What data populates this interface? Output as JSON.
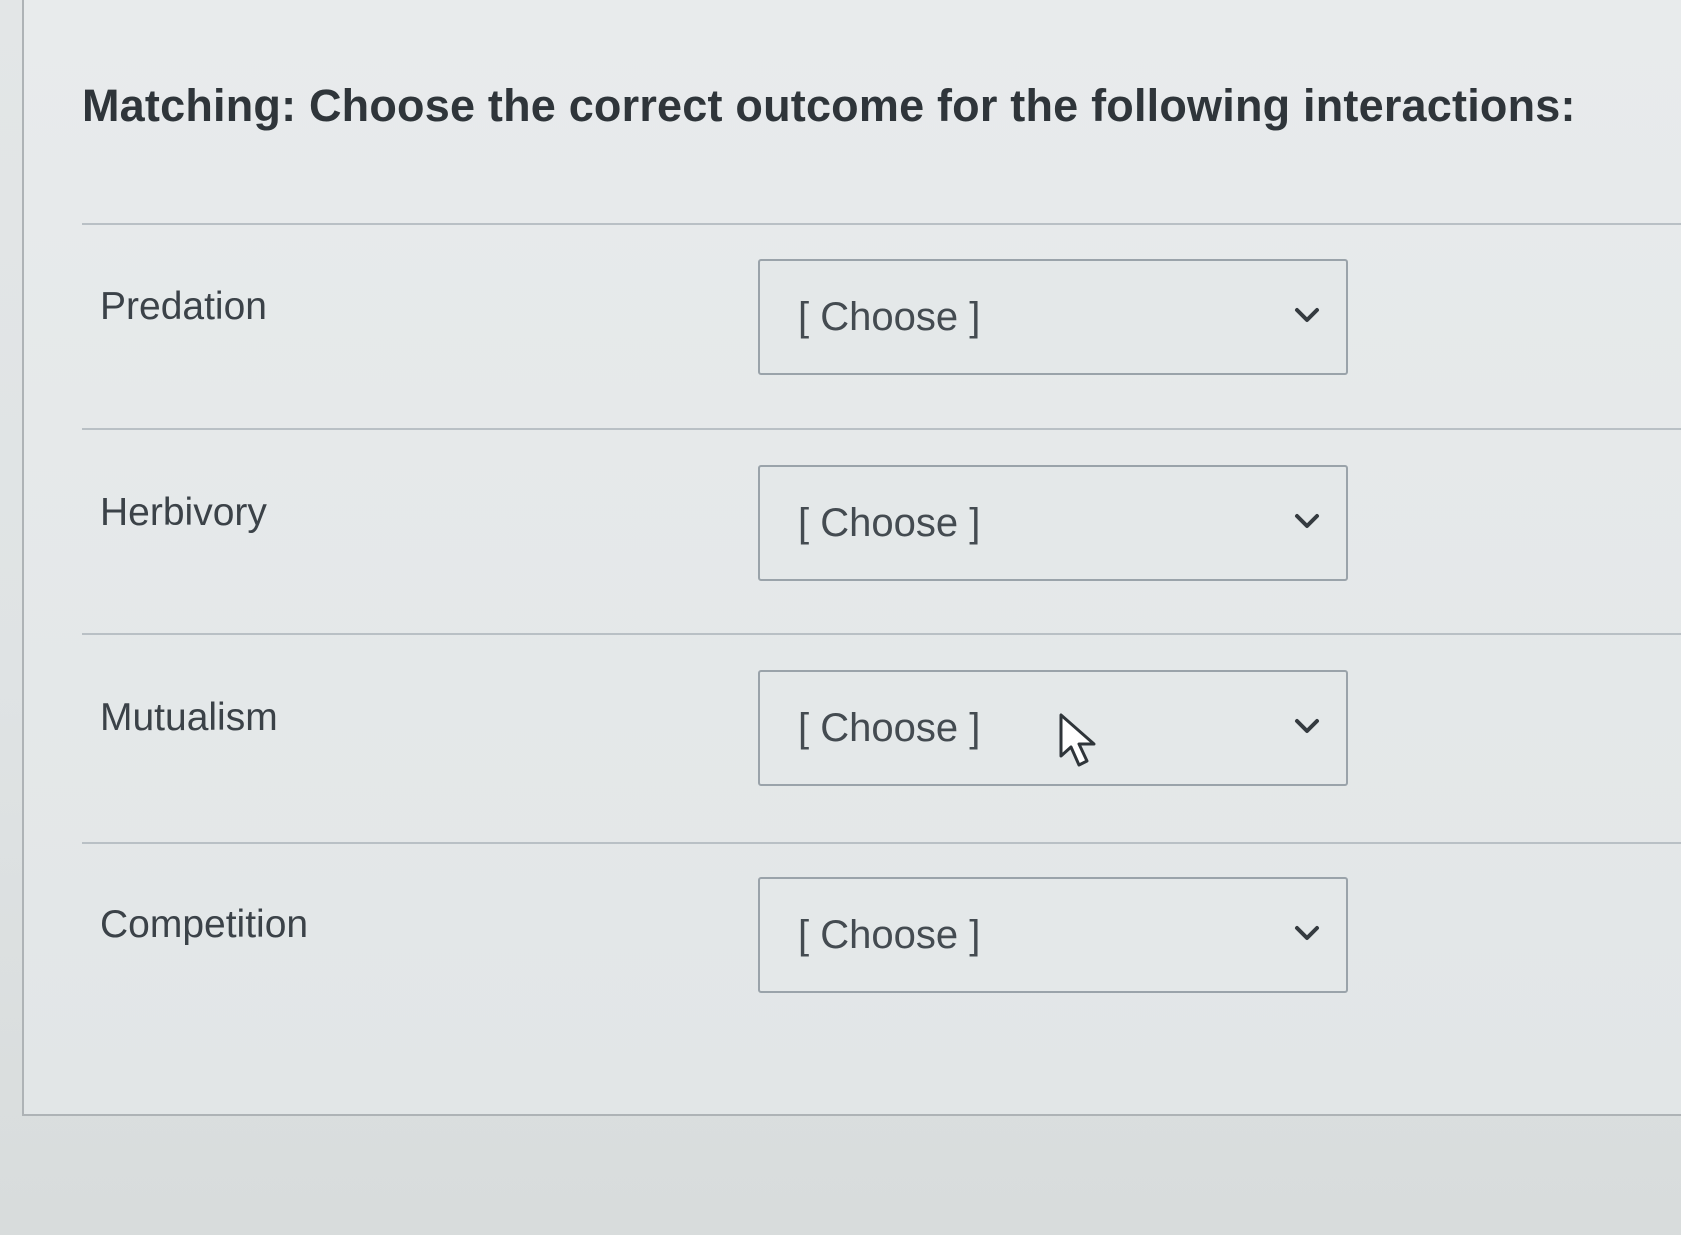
{
  "question": {
    "title": "Matching: Choose the correct outcome for the following interactions:"
  },
  "rows": [
    {
      "term": "Predation",
      "selected": "[ Choose ]"
    },
    {
      "term": "Herbivory",
      "selected": "[ Choose ]"
    },
    {
      "term": "Mutualism",
      "selected": "[ Choose ]"
    },
    {
      "term": "Competition",
      "selected": "[ Choose ]"
    }
  ],
  "icons": {
    "dropdown": "chevron-down-icon",
    "cursor": "mouse-pointer-icon"
  },
  "colors": {
    "background": "#e3e6e7",
    "text": "#3b4248",
    "border": "#9aa3aa"
  }
}
